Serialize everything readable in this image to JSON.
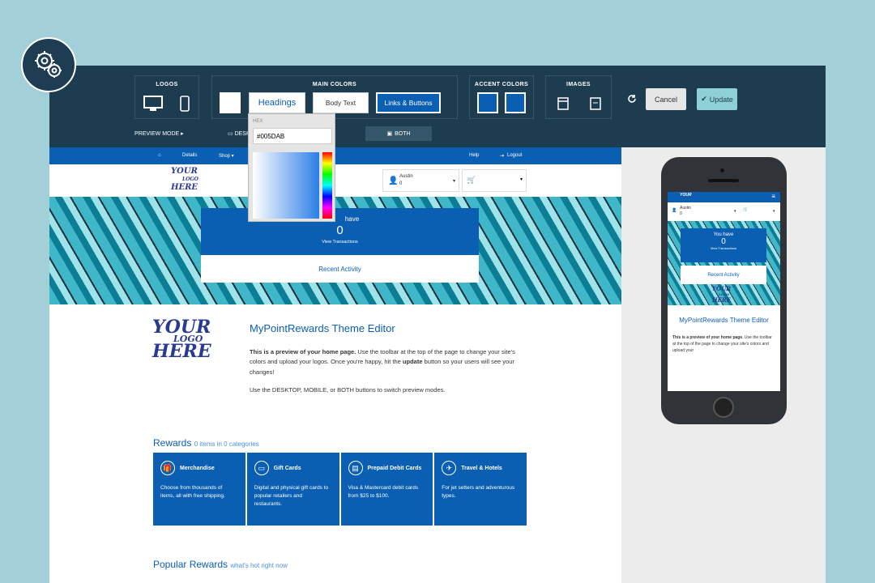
{
  "toolbar": {
    "logos_title": "LOGOS",
    "main_colors_title": "MAIN COLORS",
    "accent_colors_title": "ACCENT COLORS",
    "images_title": "IMAGES",
    "headings_label": "Headings",
    "body_text_label": "Body Text",
    "links_buttons_label": "Links & Buttons",
    "preview_mode_label": "PREVIEW MODE ▸",
    "desktop_label": "DESK",
    "both_label": "BOTH",
    "cancel_label": "Cancel",
    "update_label": "Update",
    "colors": {
      "accent1": "#0a5fb3",
      "accent2": "#0a5fb3",
      "links": "#0a5fb3"
    }
  },
  "picker": {
    "hex_label": "HEX",
    "hex_value": "#005DAB"
  },
  "preview": {
    "nav": {
      "details": "Details",
      "shop": "Shop ▾",
      "help": "Help",
      "logout": "Logout"
    },
    "logo_lines": [
      "YOUR",
      "LOGO",
      "HERE"
    ],
    "user_name": "Austin",
    "user_points": "0",
    "hero": {
      "you_have": "have",
      "points": "0",
      "view_transactions": "View Transactions",
      "recent_activity": "Recent Activity"
    },
    "editor_title": "MyPointRewards Theme Editor",
    "intro_bold": "This is a preview of your home page.",
    "intro_rest_1": " Use the toolbar at the top of the page to change your site's colors and upload your logos. Once you're happy, hit the ",
    "intro_update": "update",
    "intro_rest_2": " button so your users will see your changes!",
    "intro_p2": "Use the DESKTOP, MOBILE, or BOTH buttons to switch preview modes.",
    "rewards_title": "Rewards",
    "rewards_sub": "0 items in 0 categories",
    "reward_cards": [
      {
        "icon": "gift-icon",
        "title": "Merchandise",
        "desc": "Choose from thousands of items, all with free shipping."
      },
      {
        "icon": "gift-card-icon",
        "title": "Gift Cards",
        "desc": "Digital and physical gift cards to popular retailers and restaurants."
      },
      {
        "icon": "debit-card-icon",
        "title": "Prepaid Debit Cards",
        "desc": "Visa & Mastercard debit cards from $25 to $100."
      },
      {
        "icon": "plane-icon",
        "title": "Travel & Hotels",
        "desc": "For jet setters and adventurous types."
      }
    ],
    "popular_title": "Popular Rewards",
    "popular_sub": "what's hot right now"
  },
  "mobile": {
    "user_name": "Austin",
    "user_points": "0",
    "you_have": "You have",
    "points": "0",
    "view_transactions": "View Transactions",
    "recent_activity": "Recent Activity",
    "editor_title": "MyPointRewards Theme Editor",
    "intro_bold": "This is a preview of your home page.",
    "intro_rest": " Use the toolbar at the top of the page to change your site's colors and upload your"
  }
}
